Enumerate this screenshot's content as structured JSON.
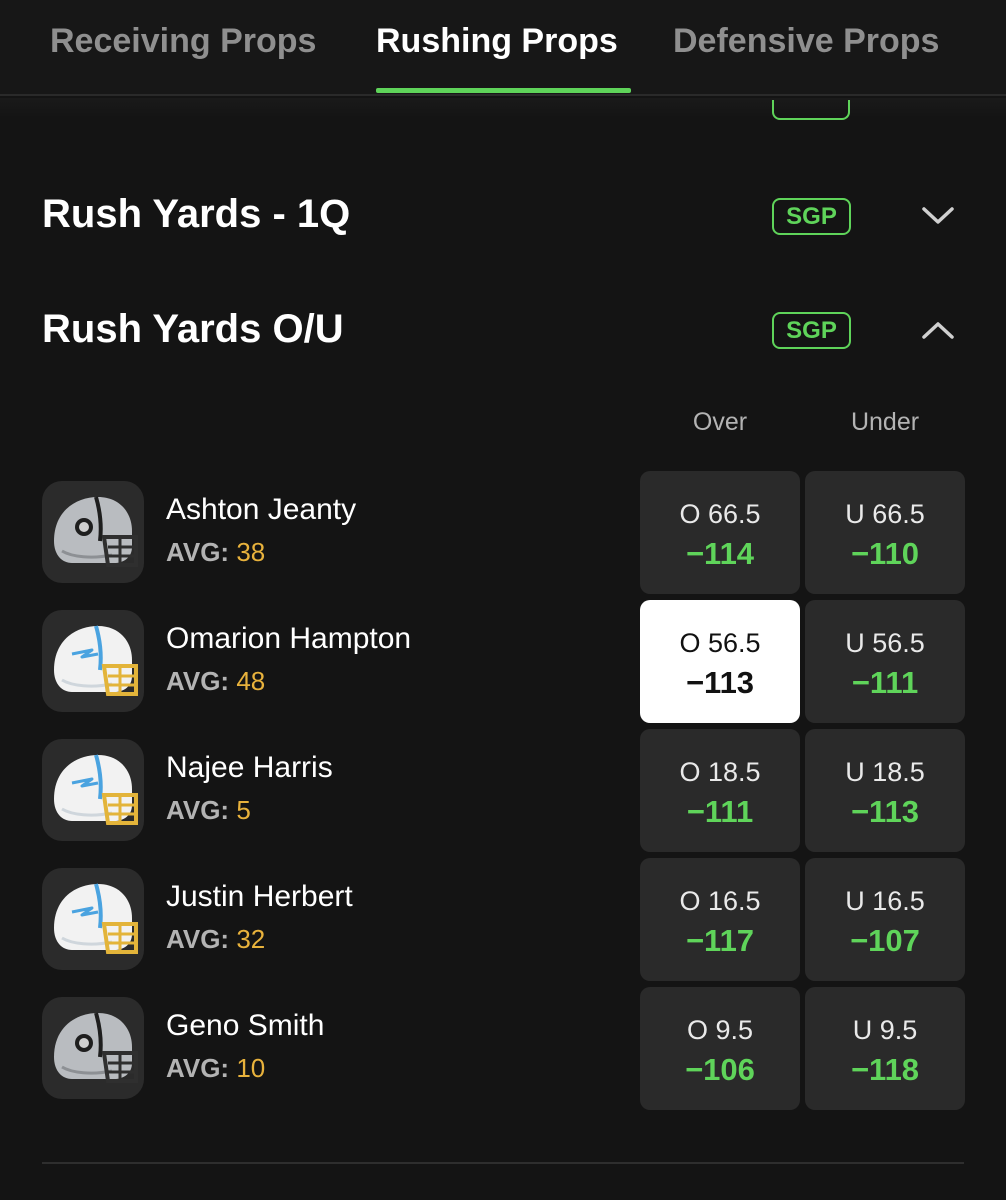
{
  "tabs": [
    "Receiving Props",
    "Rushing Props",
    "Defensive Props"
  ],
  "active_tab": "Rushing Props",
  "sections": [
    {
      "title": "Rush Yards - 1Q",
      "badge": "SGP",
      "expanded": false
    },
    {
      "title": "Rush Yards O/U",
      "badge": "SGP",
      "expanded": true
    }
  ],
  "columns": {
    "over": "Over",
    "under": "Under"
  },
  "avg_label": "AVG:",
  "players": [
    {
      "name": "Ashton Jeanty",
      "team": "raiders",
      "avg": "38",
      "over_line": "O 66.5",
      "over_price": "−114",
      "under_line": "U 66.5",
      "under_price": "−110"
    },
    {
      "name": "Omarion Hampton",
      "team": "chargers",
      "avg": "48",
      "over_line": "O 56.5",
      "over_price": "−113",
      "under_line": "U 56.5",
      "under_price": "−111",
      "selected": "over"
    },
    {
      "name": "Najee Harris",
      "team": "chargers",
      "avg": "5",
      "over_line": "O 18.5",
      "over_price": "−111",
      "under_line": "U 18.5",
      "under_price": "−113"
    },
    {
      "name": "Justin Herbert",
      "team": "chargers",
      "avg": "32",
      "over_line": "O 16.5",
      "over_price": "−117",
      "under_line": "U 16.5",
      "under_price": "−107"
    },
    {
      "name": "Geno Smith",
      "team": "raiders",
      "avg": "10",
      "over_line": "O 9.5",
      "over_price": "−106",
      "under_line": "U 9.5",
      "under_price": "−118"
    }
  ],
  "colors": {
    "accent": "#5fd45a",
    "avg_value": "#e8b23c",
    "background": "#141414",
    "odds_cell": "#2a2a2a"
  },
  "icons": {
    "collapsed": "chevron-down-icon",
    "expanded": "chevron-up-icon",
    "helmet": "helmet-icon"
  }
}
